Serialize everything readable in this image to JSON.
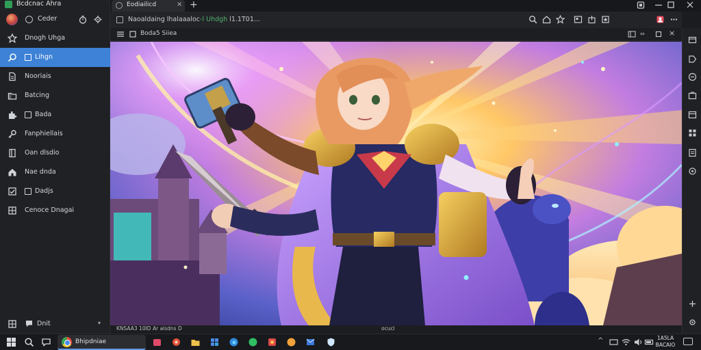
{
  "window": {
    "app_title": "Bcdcnac Ahra",
    "account_label": "Ceder"
  },
  "sidebar": {
    "items": [
      {
        "label": "Dnogh Uhga",
        "icon": "star-icon",
        "has_box": false,
        "active": false
      },
      {
        "label": "Lihgn",
        "icon": "search-icon",
        "has_box": true,
        "active": true
      },
      {
        "label": "Nooriais",
        "icon": "document-icon",
        "has_box": false,
        "active": false
      },
      {
        "label": "Batcing",
        "icon": "folder-icon",
        "has_box": false,
        "active": false
      },
      {
        "label": "Bada",
        "icon": "puzzle-icon",
        "has_box": true,
        "active": false
      },
      {
        "label": "Fanphiellais",
        "icon": "key-icon",
        "has_box": false,
        "active": false
      },
      {
        "label": "Oan dlsdio",
        "icon": "bookmark-icon",
        "has_box": false,
        "active": false
      },
      {
        "label": "Nae dnda",
        "icon": "home-icon",
        "has_box": false,
        "active": false
      },
      {
        "label": "Dadjs",
        "icon": "checkbox-icon",
        "has_box": true,
        "active": false
      },
      {
        "label": "Cenoce Dnagai",
        "icon": "grid-icon",
        "has_box": false,
        "active": false
      }
    ],
    "footer_label": "Dnit"
  },
  "browser": {
    "tab_title": "Eodiailicd",
    "address_plain": "Naoaldaing lhalaaaloc",
    "address_accent": "-l Uhdgh",
    "address_tail": "l1.1T01...",
    "subbar_title": "Boda5 Siiea"
  },
  "content": {
    "caption_left": "KNSAA3 10ID Ar alsdns D",
    "caption_center": "ocucl"
  },
  "taskbar": {
    "active_app": "Bhipdniae",
    "clock_time": "1A5LA",
    "clock_date": "BACAIO"
  }
}
